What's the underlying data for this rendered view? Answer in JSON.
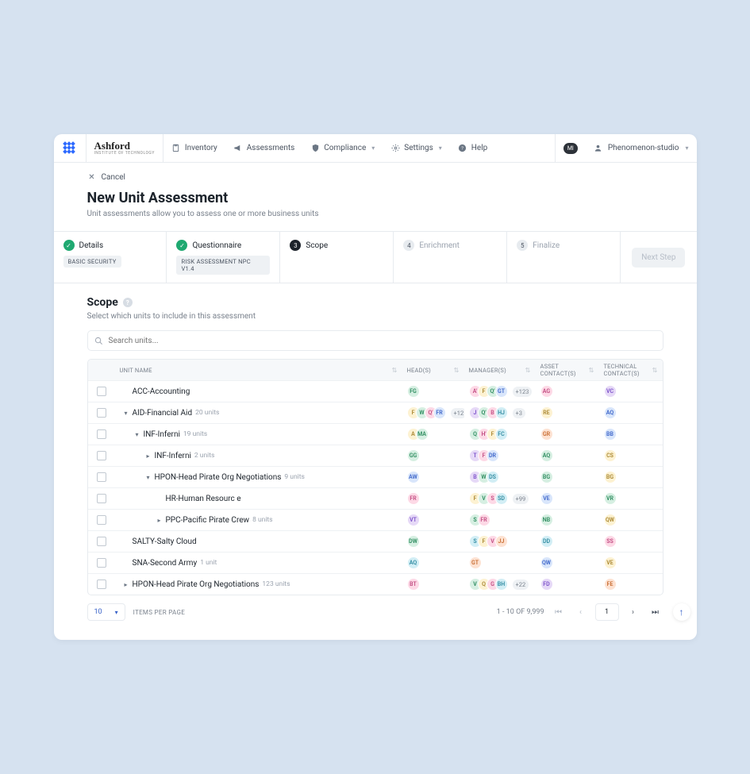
{
  "brand": {
    "name": "Ashford",
    "sub": "INSTITUTE OF TECHNOLOGY"
  },
  "nav": {
    "inventory": "Inventory",
    "assessments": "Assessments",
    "compliance": "Compliance",
    "settings": "Settings",
    "help": "Help"
  },
  "user": {
    "name": "Phenomenon-studio",
    "notif": "MI"
  },
  "cancel": "Cancel",
  "title": "New Unit Assessment",
  "subtitle": "Unit assessments allow you to assess one or more business units",
  "steps": {
    "s1": {
      "label": "Details",
      "tag": "BASIC SECURITY"
    },
    "s2": {
      "label": "Questionnaire",
      "tag": "RISK ASSESSMENT NPC V1.4"
    },
    "s3": {
      "num": "3",
      "label": "Scope"
    },
    "s4": {
      "num": "4",
      "label": "Enrichment"
    },
    "s5": {
      "num": "5",
      "label": "Finalize"
    }
  },
  "next": "Next Step",
  "section": {
    "title": "Scope",
    "sub": "Select which units to include in this assessment"
  },
  "search_ph": "Search units...",
  "cols": {
    "unit": "UNIT NAME",
    "heads": "HEAD(S)",
    "managers": "MANAGER(S)",
    "asset": "ASSET CONTACT(S)",
    "tech": "TECHNICAL CONTACT(S)"
  },
  "rows": [
    {
      "indent": 0,
      "tree": "",
      "name": "ACC-Accounting",
      "count": "",
      "heads": [
        [
          "FG",
          "c1"
        ]
      ],
      "mgrs": [
        [
          "A'",
          "c5"
        ],
        [
          "F",
          "c6"
        ],
        [
          "Q'",
          "c1"
        ],
        [
          "GT",
          "c3"
        ]
      ],
      "more": "+123",
      "asset": [
        [
          "AG",
          "c5"
        ]
      ],
      "tech": [
        [
          "VC",
          "c4"
        ]
      ]
    },
    {
      "indent": 0,
      "tree": "▾",
      "name": "AID-Financial Aid",
      "count": "20 units",
      "heads": [
        [
          "F",
          "c6"
        ],
        [
          "W",
          "c1"
        ],
        [
          "Q'",
          "c5"
        ],
        [
          "FR",
          "c3"
        ]
      ],
      "hmore": "+12",
      "mgrs": [
        [
          "J",
          "c4"
        ],
        [
          "Q'",
          "c1"
        ],
        [
          "B",
          "c5"
        ],
        [
          "HJ",
          "c7"
        ]
      ],
      "more": "+3",
      "asset": [
        [
          "RE",
          "c6"
        ]
      ],
      "tech": [
        [
          "AQ",
          "c3"
        ]
      ]
    },
    {
      "indent": 1,
      "tree": "▾",
      "name": "INF-Inferni",
      "count": "19 units",
      "heads": [
        [
          "A",
          "c6"
        ],
        [
          "MA",
          "c1"
        ]
      ],
      "mgrs": [
        [
          "Q",
          "c1"
        ],
        [
          "H'",
          "c5"
        ],
        [
          "F",
          "c6"
        ],
        [
          "FC",
          "c7"
        ]
      ],
      "asset": [
        [
          "GR",
          "c2"
        ]
      ],
      "tech": [
        [
          "BB",
          "c3"
        ]
      ]
    },
    {
      "indent": 2,
      "tree": "▸",
      "name": "INF-Inferni",
      "count": "2 units",
      "heads": [
        [
          "GG",
          "c1"
        ]
      ],
      "mgrs": [
        [
          "T",
          "c4"
        ],
        [
          "F",
          "c5"
        ],
        [
          "DR",
          "c3"
        ]
      ],
      "asset": [
        [
          "AQ",
          "c1"
        ]
      ],
      "tech": [
        [
          "CS",
          "c6"
        ]
      ]
    },
    {
      "indent": 2,
      "tree": "▾",
      "name": "HPON-Head Pirate Org Negotiations",
      "count": "9 units",
      "heads": [
        [
          "AW",
          "c3"
        ]
      ],
      "mgrs": [
        [
          "B",
          "c4"
        ],
        [
          "W",
          "c1"
        ],
        [
          "DS",
          "c7"
        ]
      ],
      "asset": [
        [
          "BG",
          "c1"
        ]
      ],
      "tech": [
        [
          "BG",
          "c6"
        ]
      ]
    },
    {
      "indent": 3,
      "tree": "",
      "name": "HR-Human Resourc e",
      "count": "",
      "heads": [
        [
          "FR",
          "c5"
        ]
      ],
      "mgrs": [
        [
          "F",
          "c6"
        ],
        [
          "V",
          "c1"
        ],
        [
          "S",
          "c5"
        ],
        [
          "SD",
          "c7"
        ]
      ],
      "more": "+99",
      "asset": [
        [
          "VE",
          "c3"
        ]
      ],
      "tech": [
        [
          "VR",
          "c1"
        ]
      ]
    },
    {
      "indent": 3,
      "tree": "▸",
      "name": "PPC-Pacific Pirate Crew",
      "count": "8 units",
      "heads": [
        [
          "VT",
          "c4"
        ]
      ],
      "mgrs": [
        [
          "S",
          "c1"
        ],
        [
          "FR",
          "c5"
        ]
      ],
      "asset": [
        [
          "NB",
          "c1"
        ]
      ],
      "tech": [
        [
          "QW",
          "c6"
        ]
      ]
    },
    {
      "indent": 0,
      "tree": "",
      "name": "SALTY-Salty Cloud",
      "count": "",
      "heads": [
        [
          "DW",
          "c1"
        ]
      ],
      "mgrs": [
        [
          "S",
          "c7"
        ],
        [
          "F",
          "c6"
        ],
        [
          "V",
          "c5"
        ],
        [
          "JJ",
          "c2"
        ]
      ],
      "asset": [
        [
          "DD",
          "c7"
        ]
      ],
      "tech": [
        [
          "SS",
          "c5"
        ]
      ]
    },
    {
      "indent": 0,
      "tree": "",
      "name": "SNA-Second Army",
      "count": "1 unit",
      "heads": [
        [
          "AQ",
          "c7"
        ]
      ],
      "mgrs": [
        [
          "GT",
          "c2"
        ]
      ],
      "asset": [
        [
          "QW",
          "c3"
        ]
      ],
      "tech": [
        [
          "VE",
          "c6"
        ]
      ]
    },
    {
      "indent": 0,
      "tree": "▸",
      "name": "HPON-Head Pirate Org Negotiations",
      "count": "123 units",
      "heads": [
        [
          "BT",
          "c5"
        ]
      ],
      "mgrs": [
        [
          "V",
          "c1"
        ],
        [
          "Q",
          "c6"
        ],
        [
          "G",
          "c5"
        ],
        [
          "BH",
          "c7"
        ]
      ],
      "more": "+22",
      "asset": [
        [
          "FD",
          "c4"
        ]
      ],
      "tech": [
        [
          "FE",
          "c2"
        ]
      ]
    }
  ],
  "pager": {
    "pp": "10",
    "ipp": "ITEMS PER PAGE",
    "range": "1 - 10 OF 9,999",
    "cur": "1"
  }
}
